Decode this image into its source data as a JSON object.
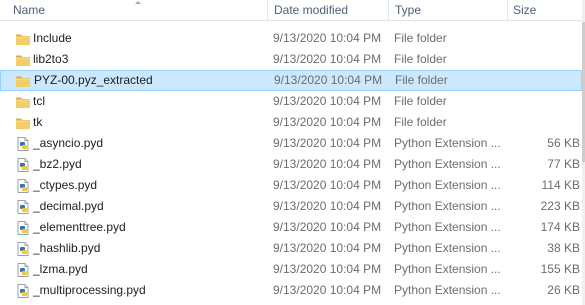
{
  "header": {
    "name": "Name",
    "date_modified": "Date modified",
    "type": "Type",
    "size": "Size"
  },
  "colors": {
    "selection": "#cce8ff",
    "selection_border": "#99d1ff",
    "folder": "#e8b949"
  },
  "rows": [
    {
      "name": "Include",
      "date": "9/13/2020 10:04 PM",
      "type": "File folder",
      "size": "",
      "icon": "folder-icon"
    },
    {
      "name": "lib2to3",
      "date": "9/13/2020 10:04 PM",
      "type": "File folder",
      "size": "",
      "icon": "folder-icon"
    },
    {
      "name": "PYZ-00.pyz_extracted",
      "date": "9/13/2020 10:04 PM",
      "type": "File folder",
      "size": "",
      "icon": "folder-icon",
      "selected": true
    },
    {
      "name": "tcl",
      "date": "9/13/2020 10:04 PM",
      "type": "File folder",
      "size": "",
      "icon": "folder-icon"
    },
    {
      "name": "tk",
      "date": "9/13/2020 10:04 PM",
      "type": "File folder",
      "size": "",
      "icon": "folder-icon"
    },
    {
      "name": "_asyncio.pyd",
      "date": "9/13/2020 10:04 PM",
      "type": "Python Extension ...",
      "size": "56 KB",
      "icon": "python-extension-icon"
    },
    {
      "name": "_bz2.pyd",
      "date": "9/13/2020 10:04 PM",
      "type": "Python Extension ...",
      "size": "77 KB",
      "icon": "python-extension-icon"
    },
    {
      "name": "_ctypes.pyd",
      "date": "9/13/2020 10:04 PM",
      "type": "Python Extension ...",
      "size": "114 KB",
      "icon": "python-extension-icon"
    },
    {
      "name": "_decimal.pyd",
      "date": "9/13/2020 10:04 PM",
      "type": "Python Extension ...",
      "size": "223 KB",
      "icon": "python-extension-icon"
    },
    {
      "name": "_elementtree.pyd",
      "date": "9/13/2020 10:04 PM",
      "type": "Python Extension ...",
      "size": "174 KB",
      "icon": "python-extension-icon"
    },
    {
      "name": "_hashlib.pyd",
      "date": "9/13/2020 10:04 PM",
      "type": "Python Extension ...",
      "size": "38 KB",
      "icon": "python-extension-icon"
    },
    {
      "name": "_lzma.pyd",
      "date": "9/13/2020 10:04 PM",
      "type": "Python Extension ...",
      "size": "155 KB",
      "icon": "python-extension-icon"
    },
    {
      "name": "_multiprocessing.pyd",
      "date": "9/13/2020 10:04 PM",
      "type": "Python Extension ...",
      "size": "26 KB",
      "icon": "python-extension-icon"
    }
  ]
}
